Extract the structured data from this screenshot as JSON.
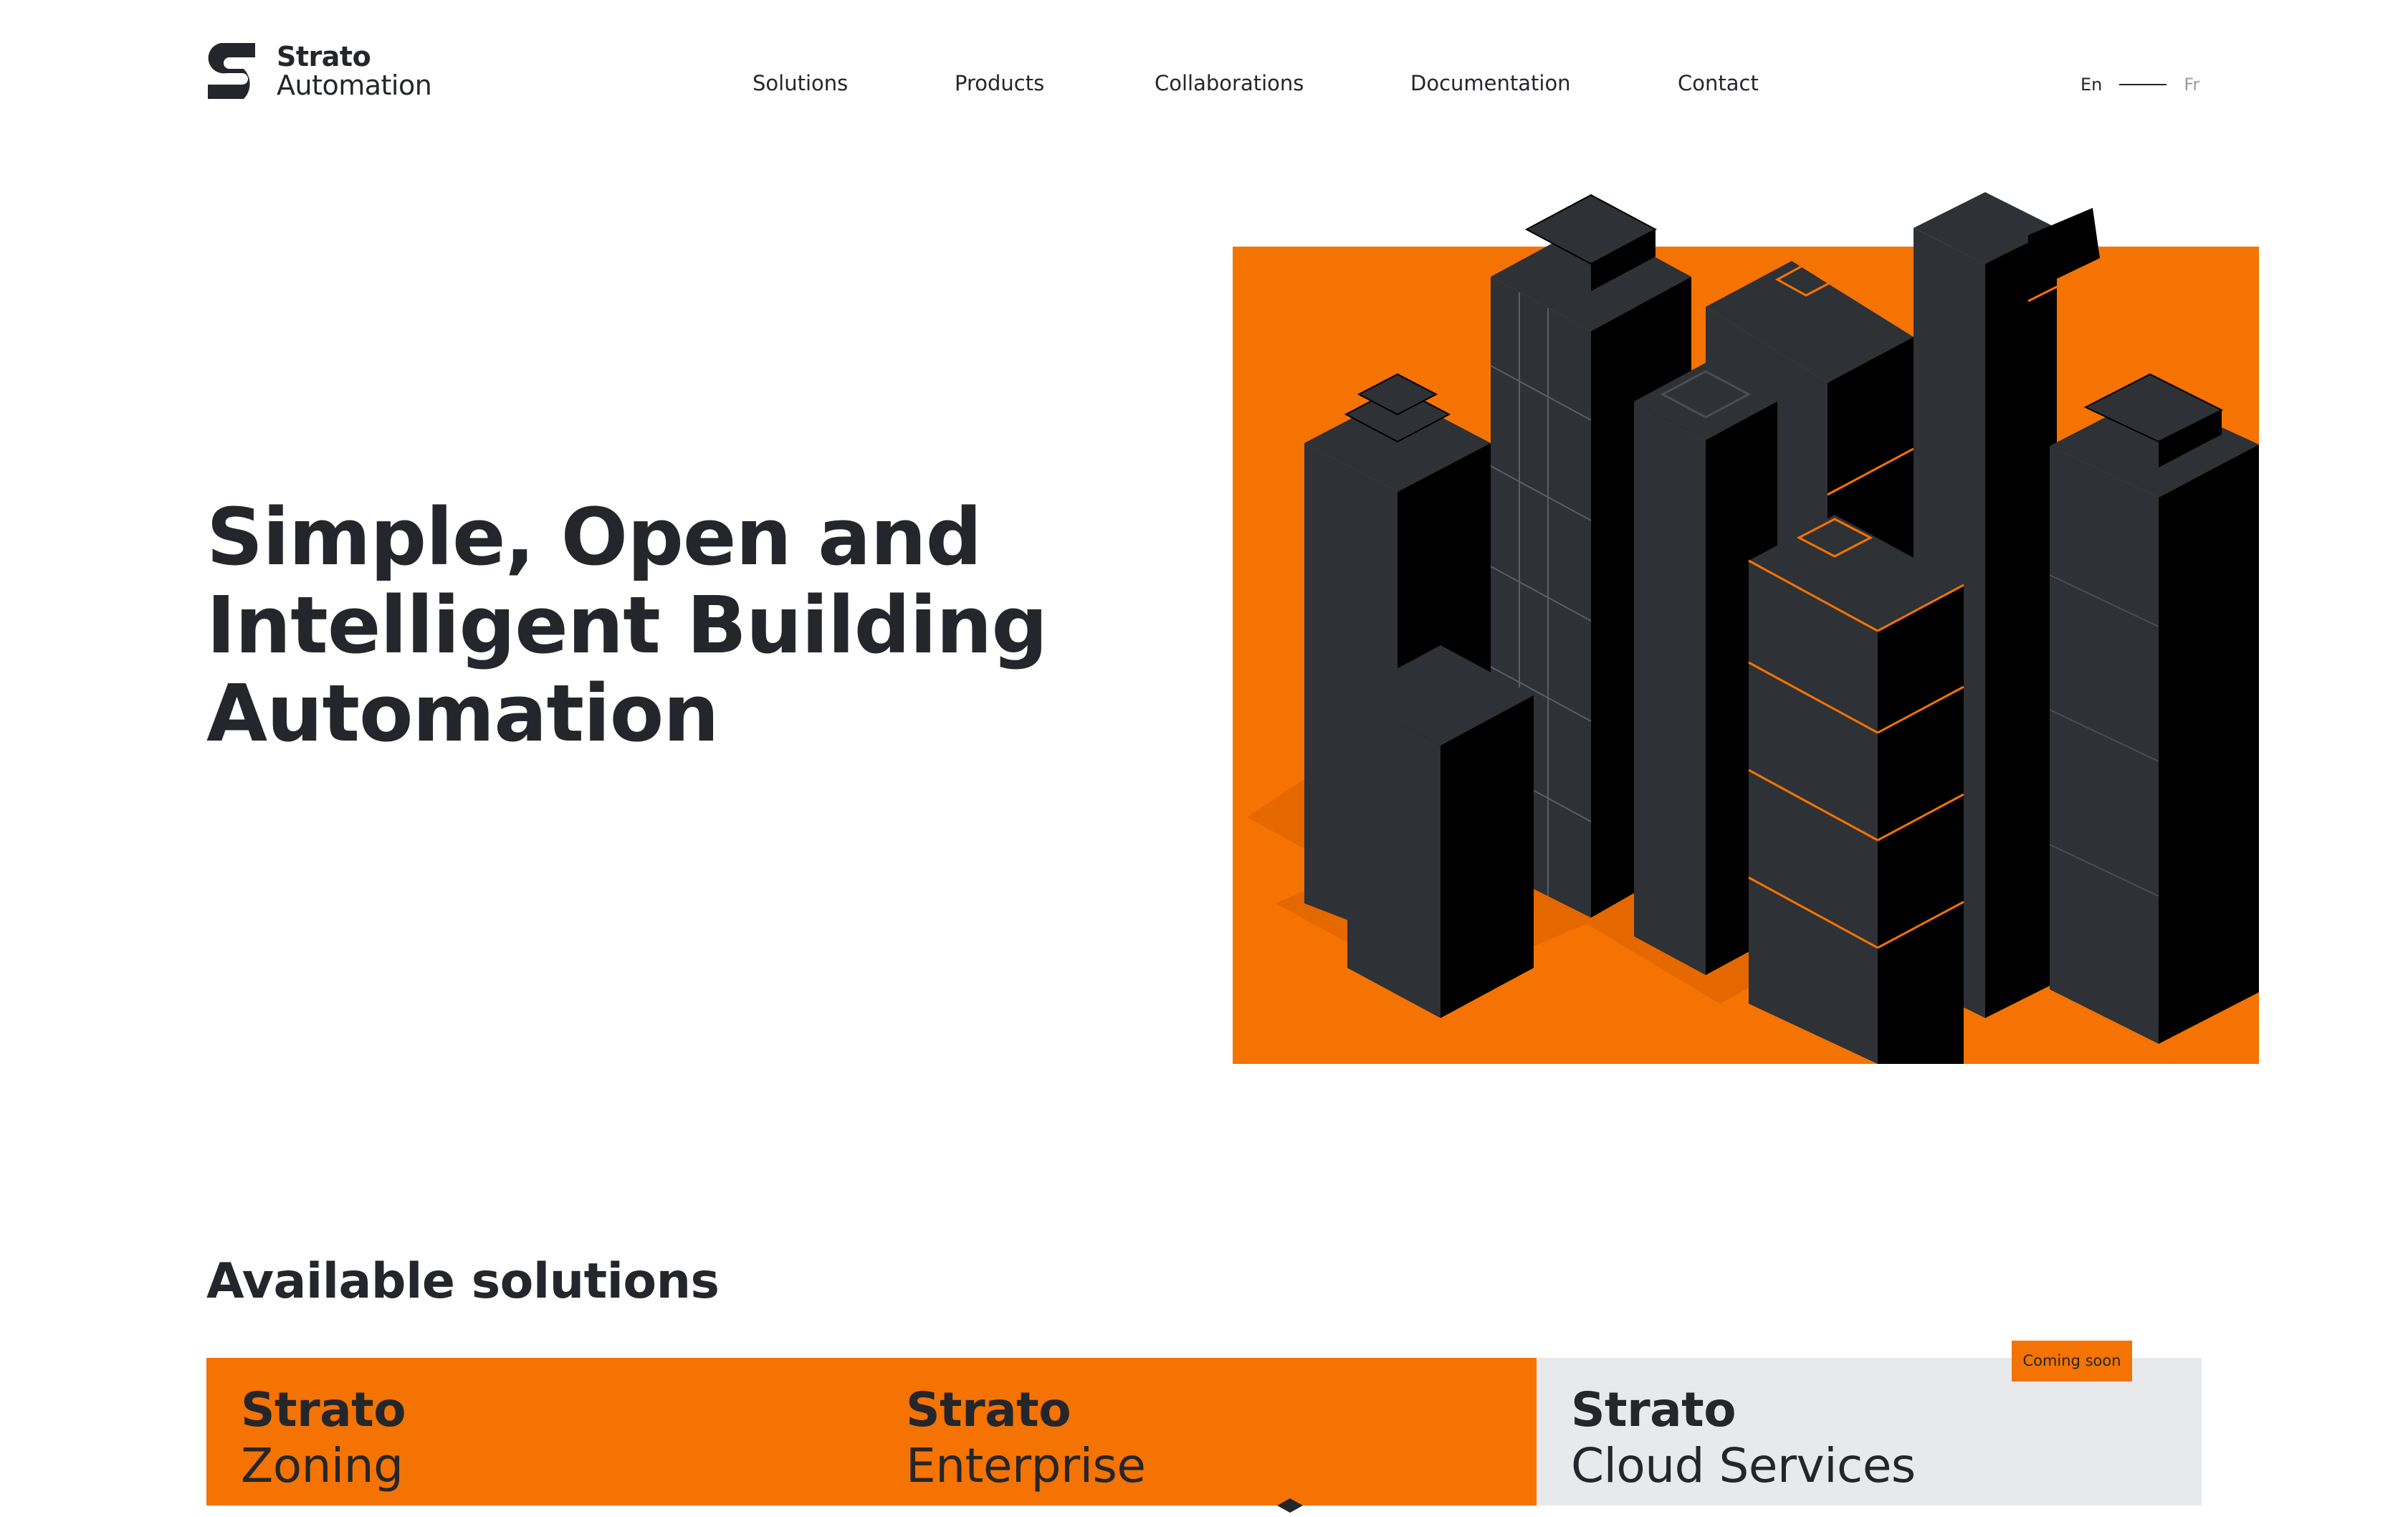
{
  "brand": {
    "line1": "Strato",
    "line2": "Automation"
  },
  "nav": {
    "items": [
      "Solutions",
      "Products",
      "Collaborations",
      "Documentation",
      "Contact"
    ]
  },
  "language": {
    "active": "En",
    "inactive": "Fr"
  },
  "hero": {
    "title": "Simple, Open and Intelligent Building Automation"
  },
  "solutions": {
    "heading": "Available solutions",
    "cards": [
      {
        "name": "Strato",
        "sub": "Zoning",
        "style": "orange"
      },
      {
        "name": "Strato",
        "sub": "Enterprise",
        "style": "orange"
      },
      {
        "name": "Strato",
        "sub": "Cloud Services",
        "style": "grey",
        "badge": "Coming soon"
      }
    ]
  },
  "colors": {
    "accent": "#f47302",
    "text": "#24262b",
    "card_grey": "#e8e9ea",
    "building": "#2e3135",
    "building_dark": "#000000"
  }
}
